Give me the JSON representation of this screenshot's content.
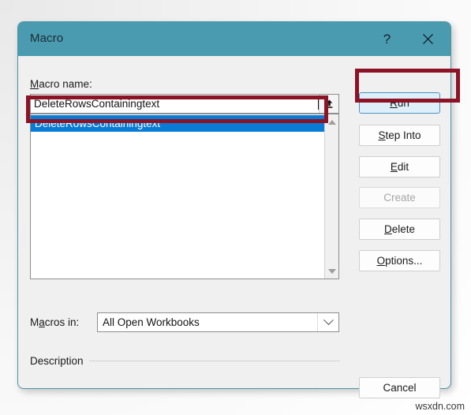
{
  "window": {
    "title": "Macro",
    "help_icon": "question-mark-icon",
    "close_icon": "close-icon"
  },
  "form": {
    "macro_name_label_prefix": "M",
    "macro_name_label_rest": "acro name:",
    "macro_name_value": "DeleteRowsContainingtext",
    "macro_name_placeholder": "",
    "upload_icon": "upload-arrow-icon"
  },
  "list": {
    "items": [
      {
        "label": "DeleteRowsContainingtext",
        "selected": true
      }
    ],
    "scroll_up_icon": "triangle-up-icon",
    "scroll_down_icon": "triangle-down-icon"
  },
  "macros_in": {
    "label_prefix": "M",
    "label_mid": "a",
    "label_rest": "cros in:",
    "selected": "All Open Workbooks",
    "options": [
      "All Open Workbooks"
    ],
    "chevron_icon": "chevron-down-icon"
  },
  "description": {
    "label": "Description",
    "text": ""
  },
  "buttons": {
    "run": {
      "accel": "R",
      "rest": "un",
      "state": "focused"
    },
    "step_into": {
      "accel": "S",
      "rest": "tep Into",
      "state": "enabled"
    },
    "edit": {
      "prefix": "",
      "accel": "E",
      "rest": "dit",
      "state": "enabled"
    },
    "create": {
      "label": "Create",
      "state": "disabled"
    },
    "delete": {
      "accel": "D",
      "rest": "elete",
      "state": "enabled"
    },
    "options": {
      "accel": "O",
      "rest": "ptions...",
      "state": "enabled"
    },
    "cancel": {
      "label": "Cancel",
      "state": "enabled"
    }
  },
  "annotations": [
    {
      "name": "run-button-highlight",
      "color": "#8c1226"
    },
    {
      "name": "selected-macro-highlight",
      "color": "#8c1226"
    }
  ],
  "watermark": {
    "text": "wsxdn.com"
  },
  "colors": {
    "titlebar": "#4a9bb0",
    "dialog_bg": "#f0f0f0",
    "selection": "#0a7bd4",
    "annotation": "#8c1226",
    "primary_button_fill": "#dfeffa"
  }
}
